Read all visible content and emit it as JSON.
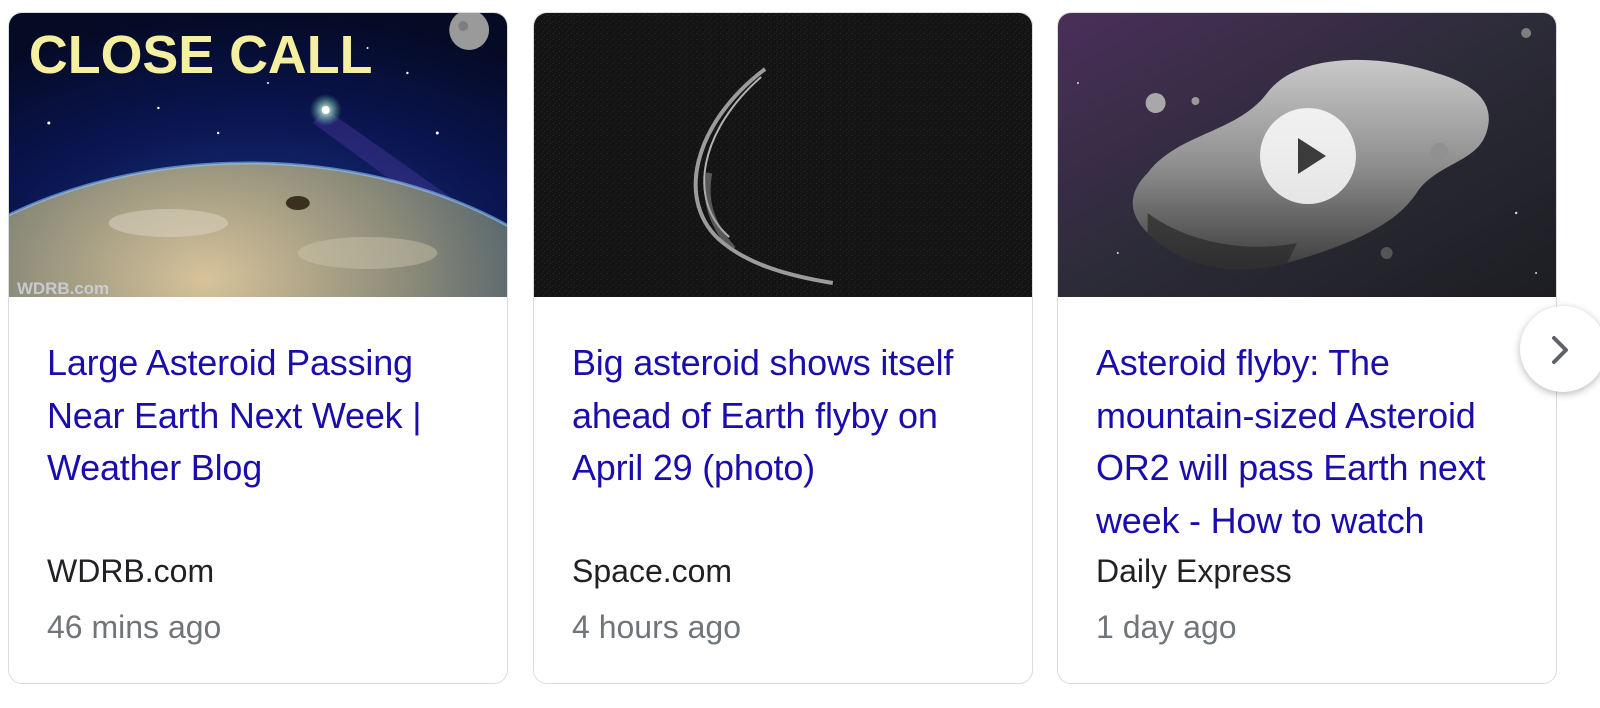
{
  "cards": [
    {
      "thumb_caption": "CLOSE CALL",
      "watermark": "WDRB.com",
      "headline": "Large Asteroid Passing Near Earth Next Week | Weather Blog",
      "source": "WDRB.com",
      "time": "46 mins ago"
    },
    {
      "headline": "Big asteroid shows itself ahead of Earth flyby on April 29 (photo)",
      "source": "Space.com",
      "time": "4 hours ago"
    },
    {
      "headline": "Asteroid flyby: The mountain-sized Asteroid OR2 will pass Earth next week - How to watch",
      "source": "Daily Express",
      "time": "1 day ago"
    }
  ],
  "colors": {
    "headline": "#1a0dab",
    "source": "#202124",
    "time": "#70757a",
    "border": "#dadce0"
  },
  "icons": {
    "play": "play-icon",
    "next": "chevron-right-icon"
  }
}
